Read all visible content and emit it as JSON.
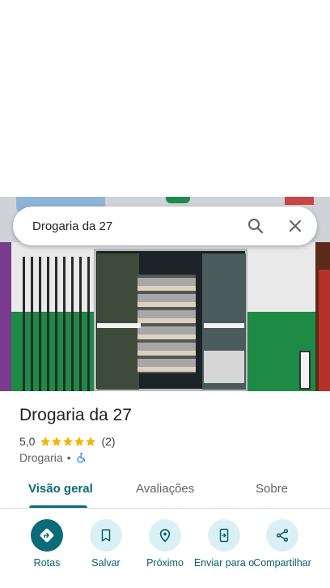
{
  "search": {
    "query": "Drogaria da 27",
    "search_icon": "search-icon",
    "close_icon": "close-icon"
  },
  "place": {
    "name": "Drogaria da 27",
    "rating": "5,0",
    "stars": 5,
    "review_count": "(2)",
    "category": "Drogaria",
    "separator": "•",
    "accessibility_icon": "wheelchair-icon"
  },
  "tabs": [
    {
      "label": "Visão geral",
      "active": true
    },
    {
      "label": "Avaliações",
      "active": false
    },
    {
      "label": "Sobre",
      "active": false
    }
  ],
  "actions": [
    {
      "label": "Rotas",
      "icon": "directions-icon"
    },
    {
      "label": "Salvar",
      "icon": "bookmark-icon"
    },
    {
      "label": "Próximo",
      "icon": "nearby-icon"
    },
    {
      "label": "Enviar para o",
      "icon": "send-to-phone-icon"
    },
    {
      "label": "Compartilhar",
      "icon": "share-icon"
    }
  ],
  "colors": {
    "accent": "#0b6b78",
    "action_bg": "#d9f1f5",
    "star": "#f4b400",
    "accessibility": "#1a73e8"
  }
}
